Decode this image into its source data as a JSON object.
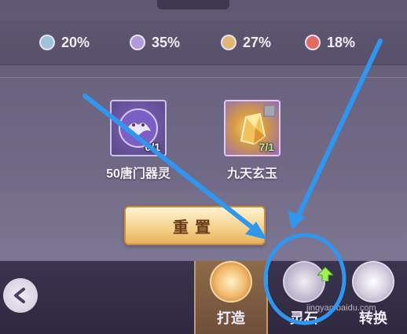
{
  "rates": [
    {
      "color": "#9ec2d9",
      "value": "20%"
    },
    {
      "color": "#b59ad9",
      "value": "35%"
    },
    {
      "color": "#e1b775",
      "value": "27%"
    },
    {
      "color": "#e36a62",
      "value": "18%"
    }
  ],
  "items": [
    {
      "name": "50唐门器灵",
      "count": "0/1"
    },
    {
      "name": "九天玄玉",
      "count": "7/1"
    }
  ],
  "reset_label": "重置",
  "tabs": [
    {
      "label": "打造"
    },
    {
      "label": "灵石"
    },
    {
      "label": "转换"
    }
  ],
  "watermark": "jingyan.baidu.com"
}
